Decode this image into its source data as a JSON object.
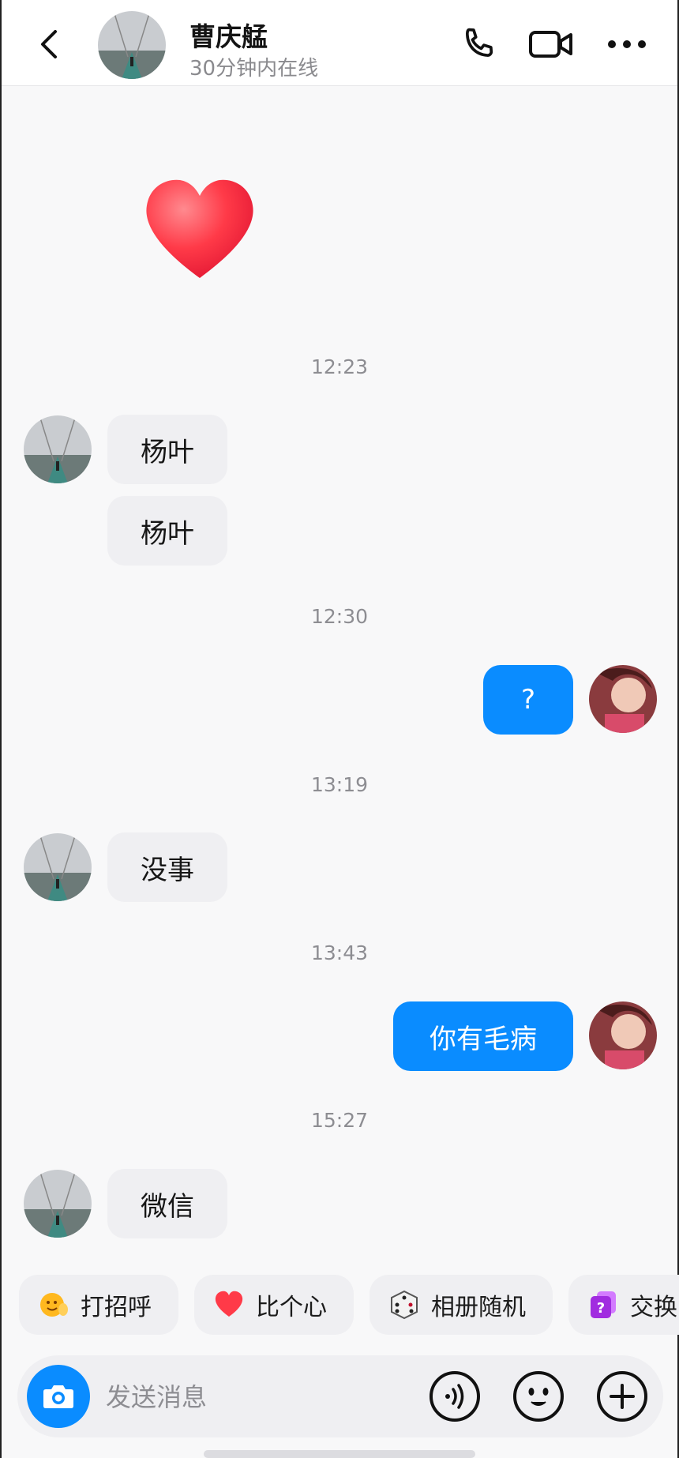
{
  "header": {
    "contact_name": "曹庆艋",
    "status": "30分钟内在线"
  },
  "messages": {
    "times": [
      "12:23",
      "12:30",
      "13:19",
      "13:43",
      "15:27"
    ],
    "m1": "杨叶",
    "m2": "杨叶",
    "m3": "?",
    "m4": "没事",
    "m5": "你有毛病",
    "m6": "微信"
  },
  "chips": [
    {
      "label": "打招呼",
      "icon": "wave-emoji-icon"
    },
    {
      "label": "比个心",
      "icon": "heart-icon"
    },
    {
      "label": "相册随机",
      "icon": "dice-icon"
    },
    {
      "label": "交换",
      "icon": "question-card-icon"
    }
  ],
  "input": {
    "placeholder": "发送消息"
  },
  "colors": {
    "accent": "#0a8cff",
    "bubble_in": "#efeff2",
    "heart": "#ff3b4e"
  }
}
